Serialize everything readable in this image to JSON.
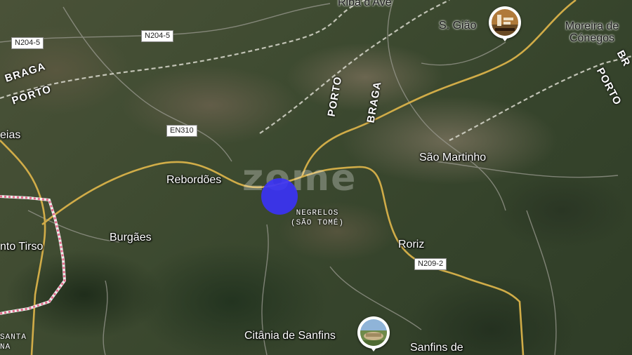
{
  "map": {
    "places": {
      "riba_de_ave": "Riba d'Ave",
      "s_giao": "S. Gião",
      "moreira_de_conegos": "Moreira de Cónegos",
      "eias": "eias",
      "reborddes": "Rebordões",
      "sao_martinho": "São Martinho",
      "burgaes": "Burgães",
      "santo_tirso": "nto Tirso",
      "roriz": "Roriz",
      "citania": "Citânia de Sanfins",
      "sanfins_de": "Sanfins de",
      "santa_line1": "SANTA",
      "santa_line2": "NA"
    },
    "parish": {
      "line1": "NEGRELOS",
      "line2": "(SÃO TOMÉ)"
    },
    "roads": {
      "n204_5_a": "N204-5",
      "n204_5_b": "N204-5",
      "en310": "EN310",
      "n209_2": "N209-2"
    },
    "road_names": {
      "braga_left": "BRAGA",
      "porto_left": "PORTO",
      "porto_center": "PORTO",
      "braga_center": "BRAGA",
      "porto_right": "PORTO",
      "br_right": "BR"
    },
    "watermark": "zome",
    "marker_color": "#3b33f5",
    "poi_icons": [
      "s-giao-poi-icon",
      "citania-poi-icon"
    ]
  }
}
